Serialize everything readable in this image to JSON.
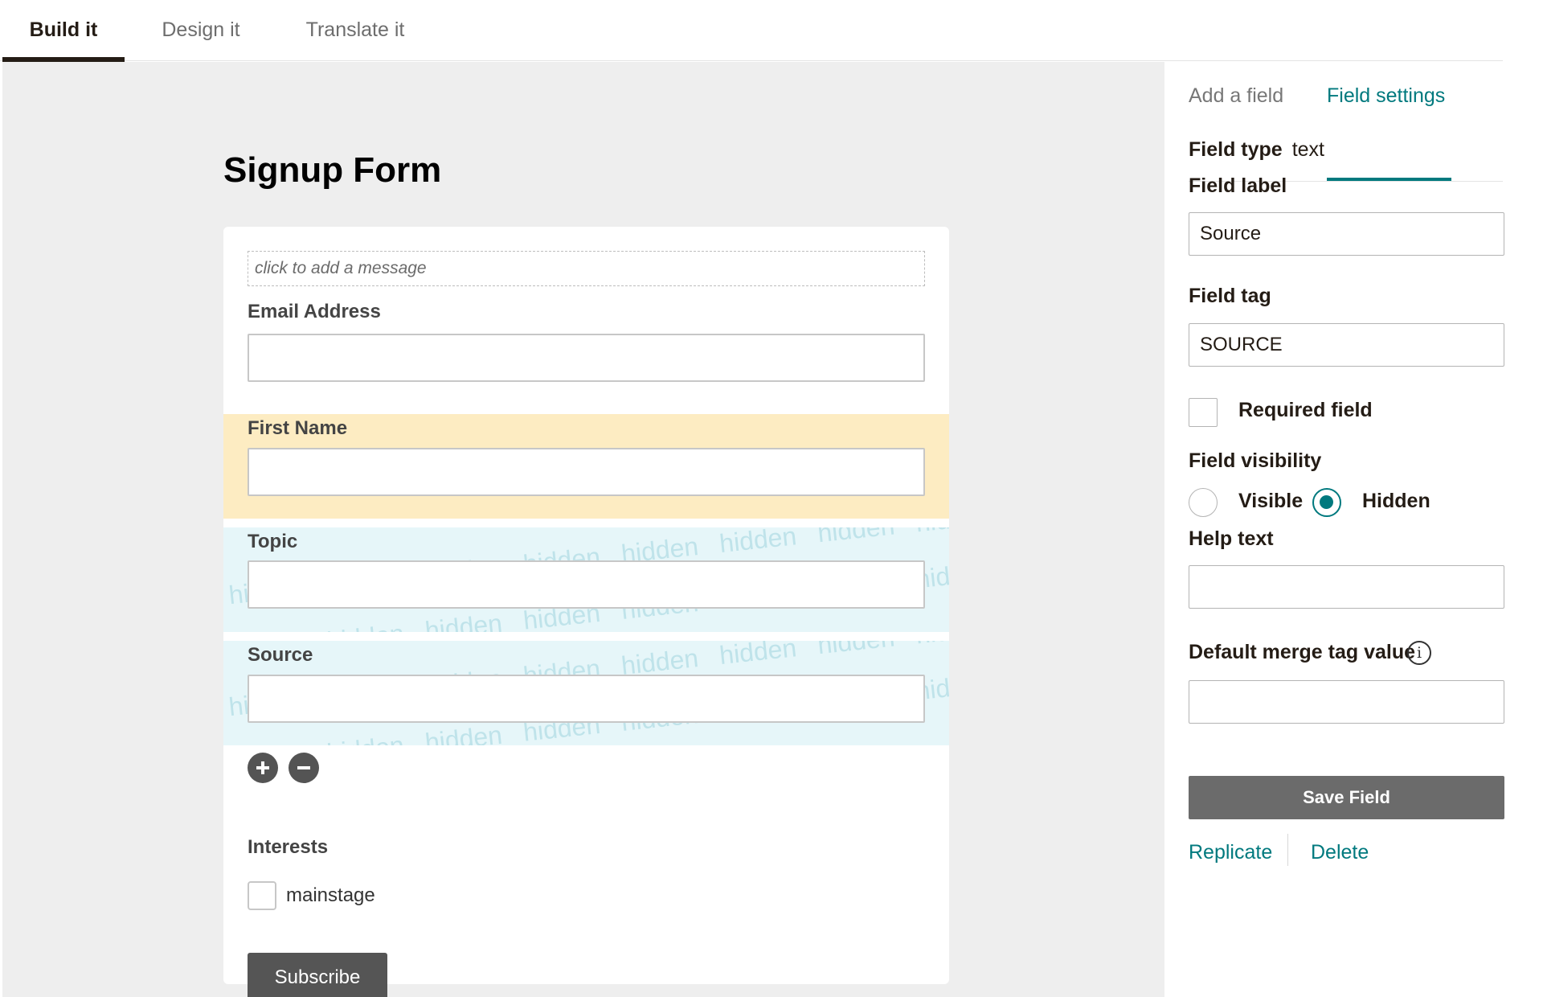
{
  "top_tabs": [
    {
      "label": "Build it",
      "active": true
    },
    {
      "label": "Design it",
      "active": false
    },
    {
      "label": "Translate it",
      "active": false
    }
  ],
  "form": {
    "title": "Signup Form",
    "message_placeholder": "click to add a message",
    "fields": [
      {
        "label": "Email Address",
        "state": "normal"
      },
      {
        "label": "First Name",
        "state": "selected"
      },
      {
        "label": "Topic",
        "state": "hidden"
      },
      {
        "label": "Source",
        "state": "hidden"
      }
    ],
    "hidden_watermark": "hidden",
    "interests": {
      "label": "Interests",
      "options": [
        {
          "label": "mainstage",
          "checked": false
        }
      ]
    },
    "subscribe_label": "Subscribe"
  },
  "panel": {
    "tabs": [
      {
        "label": "Add a field",
        "active": false
      },
      {
        "label": "Field settings",
        "active": true
      }
    ],
    "field_type_label": "Field type",
    "field_type_value": "text",
    "field_label_label": "Field label",
    "field_label_value": "Source",
    "field_tag_label": "Field tag",
    "field_tag_value": "SOURCE",
    "required_label": "Required field",
    "required_checked": false,
    "visibility_label": "Field visibility",
    "visibility_options": [
      {
        "label": "Visible",
        "checked": false
      },
      {
        "label": "Hidden",
        "checked": true
      }
    ],
    "help_text_label": "Help text",
    "help_text_value": "",
    "default_merge_label": "Default merge tag value",
    "default_merge_value": "",
    "save_label": "Save Field",
    "replicate_label": "Replicate",
    "delete_label": "Delete"
  },
  "colors": {
    "accent": "#00797e",
    "highlight": "#fdecc2",
    "hidden_band": "#e6f6f9",
    "dark_button": "#555555"
  }
}
